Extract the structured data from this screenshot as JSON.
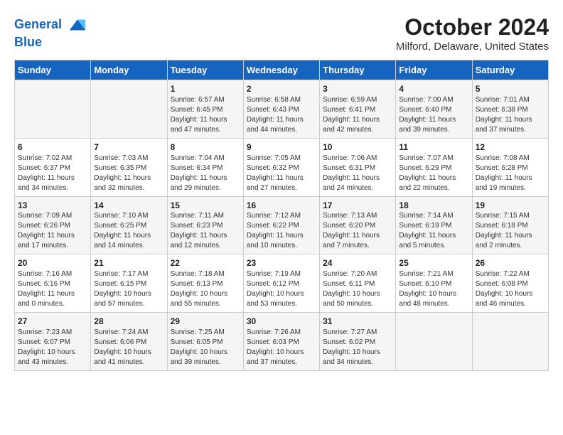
{
  "header": {
    "logo_line1": "General",
    "logo_line2": "Blue",
    "month": "October 2024",
    "location": "Milford, Delaware, United States"
  },
  "days_of_week": [
    "Sunday",
    "Monday",
    "Tuesday",
    "Wednesday",
    "Thursday",
    "Friday",
    "Saturday"
  ],
  "weeks": [
    [
      {
        "day": "",
        "info": ""
      },
      {
        "day": "",
        "info": ""
      },
      {
        "day": "1",
        "info": "Sunrise: 6:57 AM\nSunset: 6:45 PM\nDaylight: 11 hours and 47 minutes."
      },
      {
        "day": "2",
        "info": "Sunrise: 6:58 AM\nSunset: 6:43 PM\nDaylight: 11 hours and 44 minutes."
      },
      {
        "day": "3",
        "info": "Sunrise: 6:59 AM\nSunset: 6:41 PM\nDaylight: 11 hours and 42 minutes."
      },
      {
        "day": "4",
        "info": "Sunrise: 7:00 AM\nSunset: 6:40 PM\nDaylight: 11 hours and 39 minutes."
      },
      {
        "day": "5",
        "info": "Sunrise: 7:01 AM\nSunset: 6:38 PM\nDaylight: 11 hours and 37 minutes."
      }
    ],
    [
      {
        "day": "6",
        "info": "Sunrise: 7:02 AM\nSunset: 6:37 PM\nDaylight: 11 hours and 34 minutes."
      },
      {
        "day": "7",
        "info": "Sunrise: 7:03 AM\nSunset: 6:35 PM\nDaylight: 11 hours and 32 minutes."
      },
      {
        "day": "8",
        "info": "Sunrise: 7:04 AM\nSunset: 6:34 PM\nDaylight: 11 hours and 29 minutes."
      },
      {
        "day": "9",
        "info": "Sunrise: 7:05 AM\nSunset: 6:32 PM\nDaylight: 11 hours and 27 minutes."
      },
      {
        "day": "10",
        "info": "Sunrise: 7:06 AM\nSunset: 6:31 PM\nDaylight: 11 hours and 24 minutes."
      },
      {
        "day": "11",
        "info": "Sunrise: 7:07 AM\nSunset: 6:29 PM\nDaylight: 11 hours and 22 minutes."
      },
      {
        "day": "12",
        "info": "Sunrise: 7:08 AM\nSunset: 6:28 PM\nDaylight: 11 hours and 19 minutes."
      }
    ],
    [
      {
        "day": "13",
        "info": "Sunrise: 7:09 AM\nSunset: 6:26 PM\nDaylight: 11 hours and 17 minutes."
      },
      {
        "day": "14",
        "info": "Sunrise: 7:10 AM\nSunset: 6:25 PM\nDaylight: 11 hours and 14 minutes."
      },
      {
        "day": "15",
        "info": "Sunrise: 7:11 AM\nSunset: 6:23 PM\nDaylight: 11 hours and 12 minutes."
      },
      {
        "day": "16",
        "info": "Sunrise: 7:12 AM\nSunset: 6:22 PM\nDaylight: 11 hours and 10 minutes."
      },
      {
        "day": "17",
        "info": "Sunrise: 7:13 AM\nSunset: 6:20 PM\nDaylight: 11 hours and 7 minutes."
      },
      {
        "day": "18",
        "info": "Sunrise: 7:14 AM\nSunset: 6:19 PM\nDaylight: 11 hours and 5 minutes."
      },
      {
        "day": "19",
        "info": "Sunrise: 7:15 AM\nSunset: 6:18 PM\nDaylight: 11 hours and 2 minutes."
      }
    ],
    [
      {
        "day": "20",
        "info": "Sunrise: 7:16 AM\nSunset: 6:16 PM\nDaylight: 11 hours and 0 minutes."
      },
      {
        "day": "21",
        "info": "Sunrise: 7:17 AM\nSunset: 6:15 PM\nDaylight: 10 hours and 57 minutes."
      },
      {
        "day": "22",
        "info": "Sunrise: 7:18 AM\nSunset: 6:13 PM\nDaylight: 10 hours and 55 minutes."
      },
      {
        "day": "23",
        "info": "Sunrise: 7:19 AM\nSunset: 6:12 PM\nDaylight: 10 hours and 53 minutes."
      },
      {
        "day": "24",
        "info": "Sunrise: 7:20 AM\nSunset: 6:11 PM\nDaylight: 10 hours and 50 minutes."
      },
      {
        "day": "25",
        "info": "Sunrise: 7:21 AM\nSunset: 6:10 PM\nDaylight: 10 hours and 48 minutes."
      },
      {
        "day": "26",
        "info": "Sunrise: 7:22 AM\nSunset: 6:08 PM\nDaylight: 10 hours and 46 minutes."
      }
    ],
    [
      {
        "day": "27",
        "info": "Sunrise: 7:23 AM\nSunset: 6:07 PM\nDaylight: 10 hours and 43 minutes."
      },
      {
        "day": "28",
        "info": "Sunrise: 7:24 AM\nSunset: 6:06 PM\nDaylight: 10 hours and 41 minutes."
      },
      {
        "day": "29",
        "info": "Sunrise: 7:25 AM\nSunset: 6:05 PM\nDaylight: 10 hours and 39 minutes."
      },
      {
        "day": "30",
        "info": "Sunrise: 7:26 AM\nSunset: 6:03 PM\nDaylight: 10 hours and 37 minutes."
      },
      {
        "day": "31",
        "info": "Sunrise: 7:27 AM\nSunset: 6:02 PM\nDaylight: 10 hours and 34 minutes."
      },
      {
        "day": "",
        "info": ""
      },
      {
        "day": "",
        "info": ""
      }
    ]
  ]
}
